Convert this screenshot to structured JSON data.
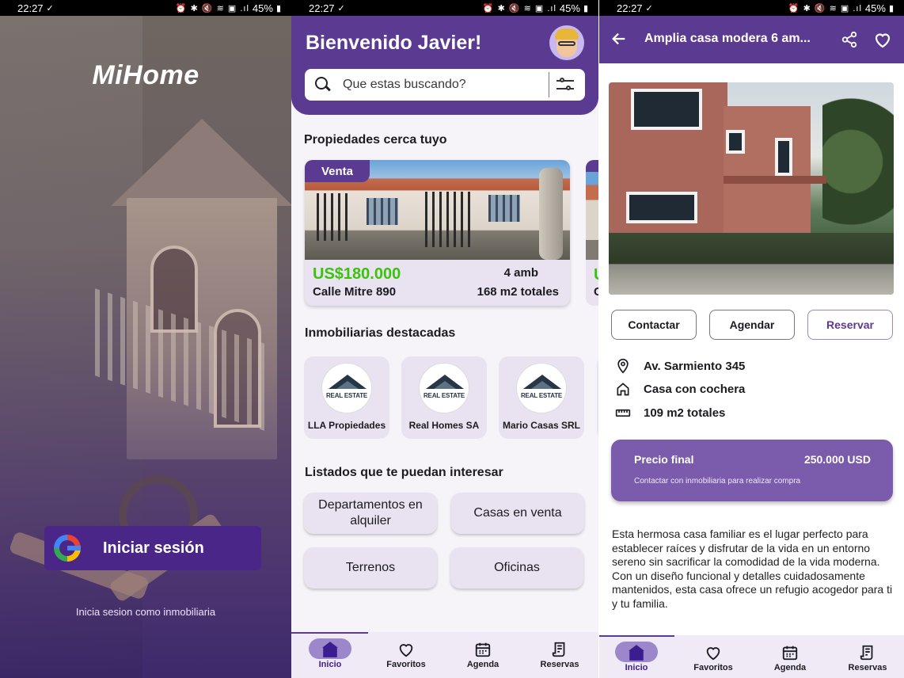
{
  "status_bar": {
    "time": "22:27",
    "battery": "45%",
    "icons": "⏰ ✱ 🔇 ≋ ▣ .ıl"
  },
  "login": {
    "logo": "MiHome",
    "google_button": "Iniciar sesión",
    "agency_link": "Inicia sesion como inmobiliaria"
  },
  "home": {
    "greeting": "Bienvenido Javier!",
    "search": {
      "placeholder": "Que estas buscando?"
    },
    "nearby_title": "Propiedades cerca tuyo",
    "featured_property": {
      "badge": "Venta",
      "price": "US$180.000",
      "rooms": "4 amb",
      "address": "Calle Mitre 890",
      "area": "168 m2 totales"
    },
    "peek_card": {
      "price_fragment": "U",
      "address_fragment": "C"
    },
    "agencies_title": "Inmobiliarias destacadas",
    "agencies": [
      {
        "name": "LLA Propiedades",
        "logo_text": "REAL ESTATE"
      },
      {
        "name": "Real Homes SA",
        "logo_text": "REAL ESTATE"
      },
      {
        "name": "Mario Casas SRL",
        "logo_text": "REAL ESTATE"
      }
    ],
    "listings_title": "Listados que te puedan interesar",
    "listings": [
      "Departamentos en alquiler",
      "Casas en venta",
      "Terrenos",
      "Oficinas"
    ]
  },
  "nav": {
    "items": [
      {
        "label": "Inicio",
        "icon": "home-icon"
      },
      {
        "label": "Favoritos",
        "icon": "heart-icon"
      },
      {
        "label": "Agenda",
        "icon": "calendar-icon"
      },
      {
        "label": "Reservas",
        "icon": "receipt-icon"
      }
    ],
    "active": "Inicio"
  },
  "detail": {
    "title": "Amplia casa modera 6 am...",
    "actions": {
      "contact": "Contactar",
      "schedule": "Agendar",
      "reserve": "Reservar"
    },
    "address": "Av. Sarmiento 345",
    "type": "Casa con cochera",
    "area": "109 m2 totales",
    "price_label": "Precio final",
    "price_value": "250.000 USD",
    "price_note": "Contactar con inmobiliaria para realizar compra",
    "description": "Esta hermosa casa familiar es el lugar perfecto para establecer raíces y disfrutar de la vida en un entorno sereno sin sacrificar la comodidad de la vida moderna. Con un diseño funcional y detalles cuidadosamente mantenidos, esta casa ofrece un refugio acogedor para ti y tu familia."
  },
  "colors": {
    "primary": "#5b3a91",
    "price_green": "#3bc20b",
    "card_bg": "#e9e3f1",
    "price_card": "#7b5bab"
  }
}
